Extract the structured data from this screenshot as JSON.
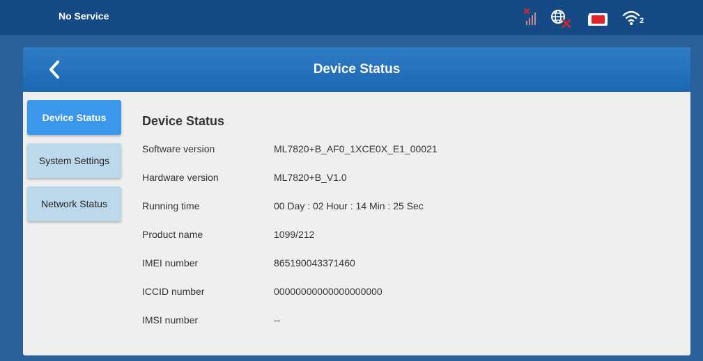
{
  "status_bar": {
    "carrier": "No Service",
    "icons": [
      "no-signal-icon",
      "no-internet-globe-icon",
      "sim-card-icon",
      "wifi-2-clients-icon"
    ],
    "wifi_clients": "2",
    "colors": {
      "bar": "#164a84",
      "alert": "#e0242a",
      "sim": "#e0242a"
    }
  },
  "header": {
    "title": "Device Status",
    "back_icon": "chevron-left-icon"
  },
  "nav": {
    "items": [
      {
        "label": "Device Status",
        "active": true
      },
      {
        "label": "System Settings",
        "active": false
      },
      {
        "label": "Network Status",
        "active": false
      }
    ]
  },
  "device_status": {
    "title": "Device Status",
    "rows": [
      {
        "label": "Software version",
        "value": "ML7820+B_AF0_1XCE0X_E1_00021"
      },
      {
        "label": "Hardware version",
        "value": "ML7820+B_V1.0"
      },
      {
        "label": "Running time",
        "value": "00 Day : 02 Hour : 14 Min : 25 Sec"
      },
      {
        "label": "Product name",
        "value": "1099/212"
      },
      {
        "label": "IMEI number",
        "value": "865190043371460"
      },
      {
        "label": "ICCID number",
        "value": "00000000000000000000"
      },
      {
        "label": "IMSI number",
        "value": "--"
      }
    ]
  },
  "colors": {
    "background": "#2b5f98",
    "header": "#1c67b1",
    "nav_active": "#3a97ec",
    "nav_inactive": "#bcd9ec",
    "panel": "#efefef"
  }
}
